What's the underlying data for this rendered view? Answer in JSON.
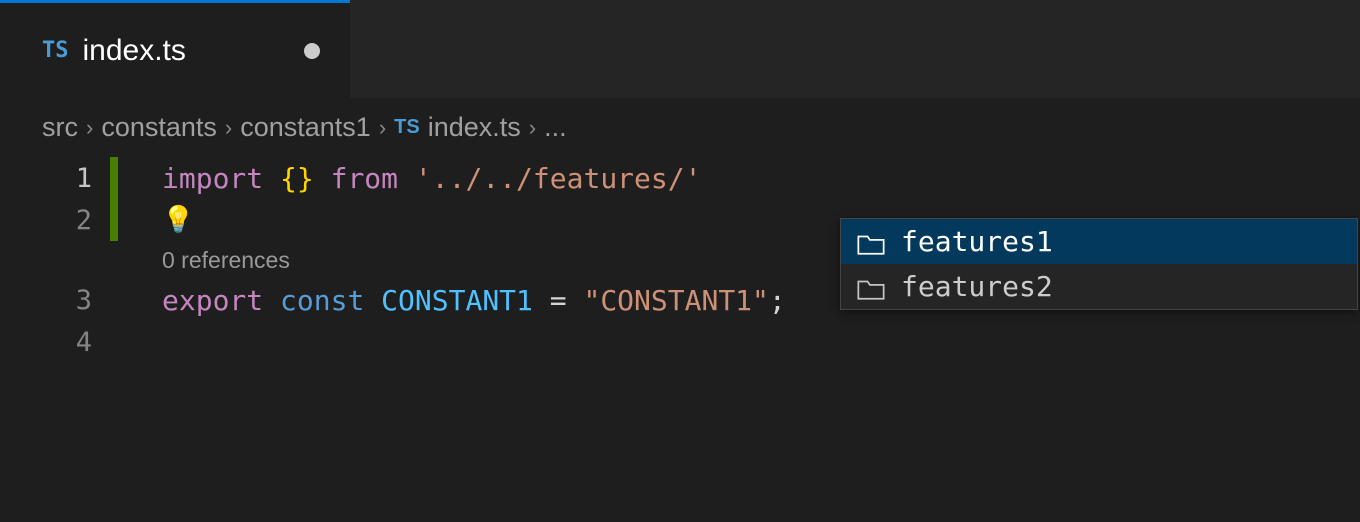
{
  "tab": {
    "icon_label": "TS",
    "title": "index.ts"
  },
  "breadcrumb": {
    "parts": [
      "src",
      "constants",
      "constants1"
    ],
    "file_icon": "TS",
    "file": "index.ts",
    "trailing": "..."
  },
  "code": {
    "line1": {
      "num": "1",
      "import_kw": "import",
      "braces": "{}",
      "from_kw": "from",
      "string": "'../../features/'"
    },
    "line2": {
      "num": "2"
    },
    "codelens": "0 references",
    "line3": {
      "num": "3",
      "export_kw": "export",
      "const_kw": "const",
      "name": "CONSTANT1",
      "eq": "=",
      "value": "\"CONSTANT1\"",
      "semi": ";"
    },
    "line4": {
      "num": "4"
    }
  },
  "suggestions": {
    "items": [
      {
        "label": "features1"
      },
      {
        "label": "features2"
      }
    ]
  }
}
